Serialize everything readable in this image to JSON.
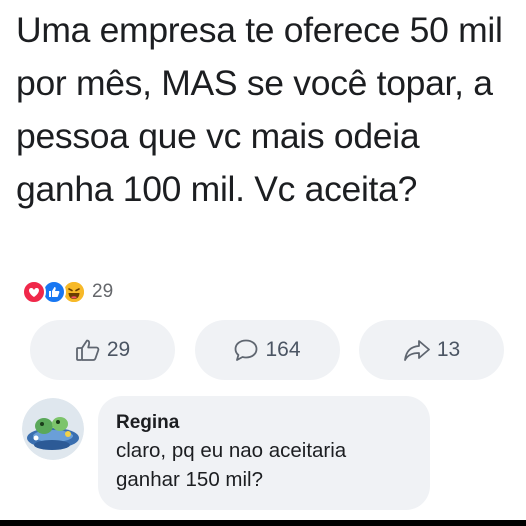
{
  "post": {
    "text": "Uma empresa te oferece 50 mil por mês, MAS se você topar, a pessoa que vc mais odeia ganha 100 mil.  Vc aceita?"
  },
  "reactions": {
    "icons": [
      "love-icon",
      "like-icon",
      "haha-icon"
    ],
    "count": "29"
  },
  "actions": {
    "like_count": "29",
    "comment_count": "164",
    "share_count": "13"
  },
  "comment": {
    "author": "Regina",
    "text": "claro, pq eu nao aceitaria ganhar 150 mil?"
  },
  "colors": {
    "like_blue": "#1877f2",
    "love_red": "#f0284a",
    "haha_yellow": "#f7b928",
    "bubble_bg": "#f0f2f5"
  }
}
